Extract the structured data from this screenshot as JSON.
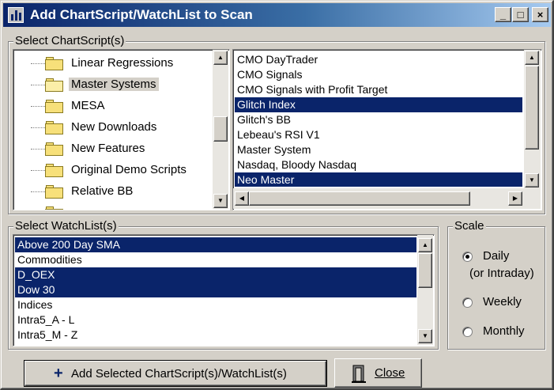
{
  "window": {
    "title": "Add ChartScript/WatchList to Scan",
    "controls": {
      "minimize": "_",
      "maximize": "□",
      "close": "×"
    }
  },
  "chartscript_group": {
    "label": "Select ChartScript(s)",
    "folders": [
      {
        "label": "Linear Regressions",
        "selected": false
      },
      {
        "label": "Master Systems",
        "selected": true,
        "open": true
      },
      {
        "label": "MESA",
        "selected": false
      },
      {
        "label": "New Downloads",
        "selected": false
      },
      {
        "label": "New Features",
        "selected": false
      },
      {
        "label": "Original Demo Scripts",
        "selected": false
      },
      {
        "label": "Relative BB",
        "selected": false
      }
    ],
    "scripts": [
      {
        "label": "CMO DayTrader",
        "selected": false
      },
      {
        "label": "CMO Signals",
        "selected": false
      },
      {
        "label": "CMO Signals with Profit Target",
        "selected": false
      },
      {
        "label": "Glitch Index",
        "selected": true
      },
      {
        "label": "Glitch's BB",
        "selected": false
      },
      {
        "label": "Lebeau's RSI V1",
        "selected": false
      },
      {
        "label": "Master System",
        "selected": false
      },
      {
        "label": "Nasdaq, Bloody Nasdaq",
        "selected": false
      },
      {
        "label": "Neo Master",
        "selected": true
      }
    ]
  },
  "watchlist_group": {
    "label": "Select WatchList(s)",
    "items": [
      {
        "label": "Above 200 Day SMA",
        "selected": true
      },
      {
        "label": "Commodities",
        "selected": false
      },
      {
        "label": "D_OEX",
        "selected": true
      },
      {
        "label": "Dow 30",
        "selected": true
      },
      {
        "label": "Indices",
        "selected": false
      },
      {
        "label": "Intra5_A - L",
        "selected": false
      },
      {
        "label": "Intra5_M - Z",
        "selected": false
      }
    ]
  },
  "scale_group": {
    "label": "Scale",
    "options": [
      {
        "label": "Daily",
        "sublabel": "(or Intraday)",
        "checked": true
      },
      {
        "label": "Weekly",
        "checked": false
      },
      {
        "label": "Monthly",
        "checked": false
      }
    ]
  },
  "buttons": {
    "add_label": "Add Selected ChartScript(s)/WatchList(s)",
    "add_icon": "plus-icon",
    "close_label": "Close",
    "close_icon": "door-icon"
  },
  "colors": {
    "selection": "#0a246a",
    "title_gradient_start": "#0a246a",
    "face": "#d4d0c8"
  }
}
